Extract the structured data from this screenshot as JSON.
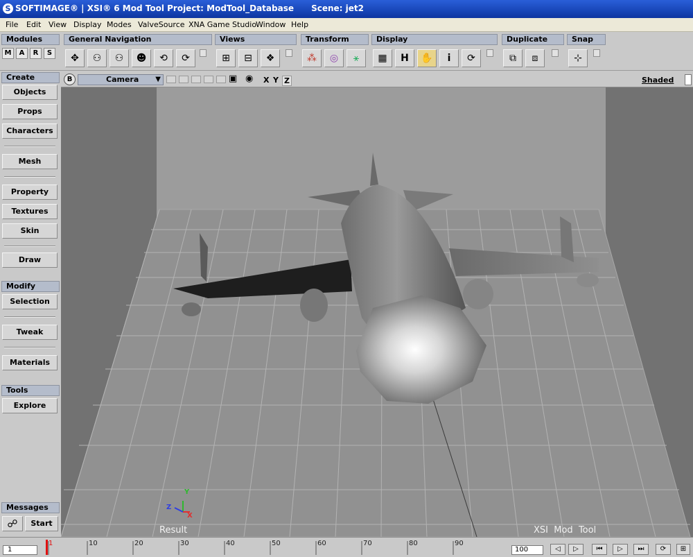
{
  "title": {
    "brand": "SOFTIMAGE®",
    "project": "XSI® 6 Mod Tool Project: ModTool_Database",
    "scene": "Scene: jet2"
  },
  "menu": [
    "File",
    "Edit",
    "View",
    "Display",
    "Modes",
    "ValveSource",
    "XNA Game Studio",
    "Window",
    "Help"
  ],
  "toolbar": {
    "modules": {
      "label": "Modules",
      "buttons": [
        "M",
        "A",
        "R",
        "S"
      ]
    },
    "general_navigation": "General Navigation",
    "views": "Views",
    "transform": "Transform",
    "display": "Display",
    "duplicate": "Duplicate",
    "snap": "Snap",
    "icons": [
      "navigate-icon",
      "camera-orbit-icon",
      "camera-pan-icon",
      "camera-dolly-icon",
      "camera-track-icon",
      "camera-zoom-icon",
      "hierarchy-view-icon",
      "schematic-view-icon",
      "explorer-icon",
      "transform-axes-icon",
      "rotate-icon",
      "scale-icon",
      "grid-icon",
      "hide-icon",
      "hand-icon",
      "info-icon",
      "refresh-icon",
      "duplicate-icon",
      "duplicate-symmetry-icon",
      "snap-icon"
    ],
    "display_h": "H",
    "display_i": "i"
  },
  "left_panel": {
    "create_header": "Create",
    "create_buttons": [
      "Objects",
      "Props",
      "Characters",
      "Mesh",
      "Property",
      "Textures",
      "Skin",
      "Draw"
    ],
    "modify_header": "Modify",
    "modify_buttons": [
      "Selection",
      "Tweak",
      "Materials"
    ],
    "tools_header": "Tools",
    "tools_buttons": [
      "Explore"
    ],
    "messages_header": "Messages",
    "start_label": "Start"
  },
  "viewport": {
    "letter": "B",
    "camera": "Camera",
    "axes": [
      "X",
      "Y",
      "Z"
    ],
    "mode": "Shaded",
    "result_label": "Result",
    "watermark": "XSI  Mod  Tool",
    "gizmo": {
      "x": "X",
      "y": "Y",
      "z": "Z"
    }
  },
  "timeline": {
    "current_frame": "1",
    "ticks": [
      "1",
      "10",
      "20",
      "30",
      "40",
      "50",
      "60",
      "70",
      "80",
      "90"
    ],
    "end_frame": "100"
  },
  "colors": {
    "title_bar": "#1846b8",
    "panel": "#c9c9c9",
    "header": "#b4bccb",
    "viewport": "#727272",
    "grid": "#9a9a9a"
  }
}
